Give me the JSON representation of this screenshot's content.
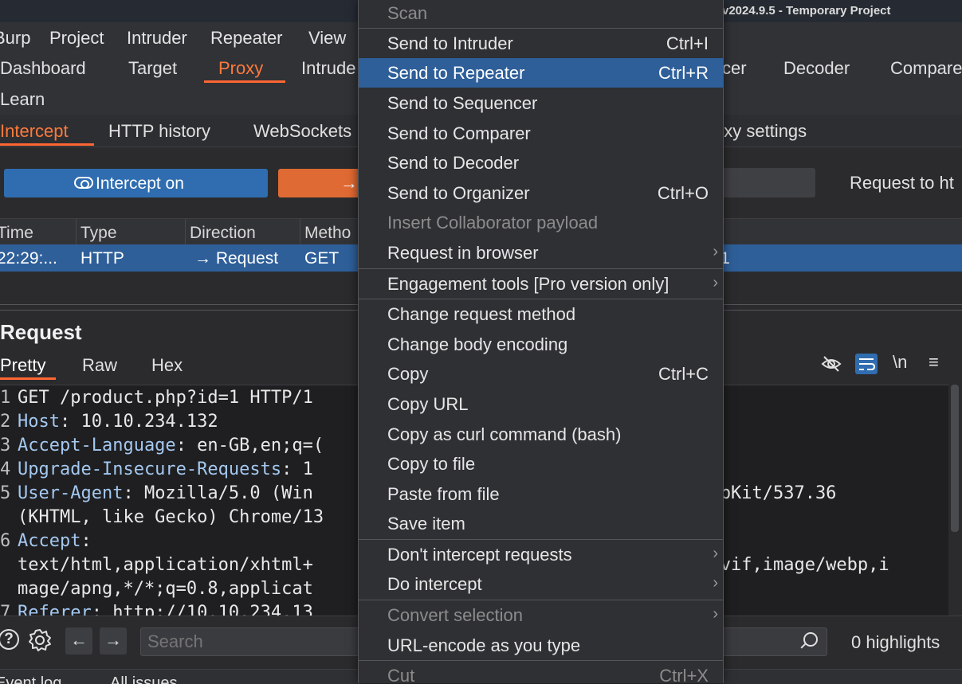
{
  "window": {
    "title": "v2024.9.5 - Temporary Project"
  },
  "menubar": [
    "Burp",
    "Project",
    "Intruder",
    "Repeater",
    "View"
  ],
  "main_tabs": {
    "row1": [
      "Dashboard",
      "Target",
      "Proxy",
      "Intrude",
      "cer",
      "Decoder",
      "Compare"
    ],
    "row2": [
      "Learn"
    ],
    "active": "Proxy"
  },
  "proxy_tabs": [
    "Intercept",
    "HTTP history",
    "WebSockets",
    "oxy settings"
  ],
  "toolbar": {
    "intercept_label": "Intercept on",
    "forward_label": "→",
    "request_to": "Request to ht"
  },
  "table": {
    "columns": [
      "Time",
      "Type",
      "Direction",
      "Metho"
    ],
    "rows": [
      {
        "time": "22:29:...",
        "type": "HTTP",
        "direction": "→  Request",
        "method": "GET",
        "tail": "1"
      }
    ]
  },
  "request": {
    "title": "Request",
    "tabs": [
      "Pretty",
      "Raw",
      "Hex"
    ],
    "tools": [
      "\\n",
      "≡"
    ],
    "lines": [
      {
        "n": "1",
        "text": "GET /product.php?id=1 HTTP/1",
        "tail": ""
      },
      {
        "n": "2",
        "key": "Host",
        "text": ": 10.10.234.132",
        "tail": ""
      },
      {
        "n": "3",
        "key": "Accept-Language",
        "text": ": en-GB,en;q=(",
        "tail": ""
      },
      {
        "n": "4",
        "key": "Upgrade-Insecure-Requests",
        "text": ": 1",
        "tail": ""
      },
      {
        "n": "5",
        "key": "User-Agent",
        "text": ": Mozilla/5.0 (Win",
        "tail": "eWebKit/537.36"
      },
      {
        "n": "",
        "text": "(KHTML, like Gecko) Chrome/13",
        "tail": ""
      },
      {
        "n": "6",
        "key": "Accept",
        "text": ":",
        "tail": ""
      },
      {
        "n": "",
        "text": "text/html,application/xhtml+",
        "tail": "e/avif,image/webp,i"
      },
      {
        "n": "",
        "text": "mage/apng,*/*;q=0.8,applicat",
        "tail": ""
      },
      {
        "n": "7",
        "key": "Referer",
        "text": ": http://10.10.234.13",
        "tail": ""
      }
    ]
  },
  "search": {
    "placeholder": "Search",
    "highlights": "0 highlights"
  },
  "statusbar": [
    "Event log",
    "All issues"
  ],
  "context_menu": [
    {
      "label": "Scan",
      "shortcut": "",
      "disabled": true
    },
    {
      "sep": true
    },
    {
      "label": "Send to Intruder",
      "shortcut": "Ctrl+I"
    },
    {
      "label": "Send to Repeater",
      "shortcut": "Ctrl+R",
      "selected": true
    },
    {
      "label": "Send to Sequencer",
      "shortcut": ""
    },
    {
      "label": "Send to Comparer",
      "shortcut": ""
    },
    {
      "label": "Send to Decoder",
      "shortcut": ""
    },
    {
      "label": "Send to Organizer",
      "shortcut": "Ctrl+O"
    },
    {
      "label": "Insert Collaborator payload",
      "shortcut": "",
      "disabled": true
    },
    {
      "label": "Request in browser",
      "submenu": true
    },
    {
      "sep": true
    },
    {
      "label": "Engagement tools [Pro version only]",
      "submenu": true
    },
    {
      "sep": true
    },
    {
      "label": "Change request method",
      "shortcut": ""
    },
    {
      "label": "Change body encoding",
      "shortcut": ""
    },
    {
      "label": "Copy",
      "shortcut": "Ctrl+C"
    },
    {
      "label": "Copy URL",
      "shortcut": ""
    },
    {
      "label": "Copy as curl command (bash)",
      "shortcut": ""
    },
    {
      "label": "Copy to file",
      "shortcut": ""
    },
    {
      "label": "Paste from file",
      "shortcut": ""
    },
    {
      "label": "Save item",
      "shortcut": ""
    },
    {
      "sep": true
    },
    {
      "label": "Don't intercept requests",
      "submenu": true
    },
    {
      "label": "Do intercept",
      "submenu": true
    },
    {
      "sep": true
    },
    {
      "label": "Convert selection",
      "submenu": true,
      "disabled": true
    },
    {
      "label": "URL-encode as you type",
      "shortcut": ""
    },
    {
      "sep": true
    },
    {
      "label": "Cut",
      "shortcut": "Ctrl+X",
      "disabled": true
    }
  ],
  "colors": {
    "accent": "#ff6633",
    "selection": "#2e5f99",
    "intercept_button": "#2f6db0",
    "forward_button": "#e06a33"
  }
}
